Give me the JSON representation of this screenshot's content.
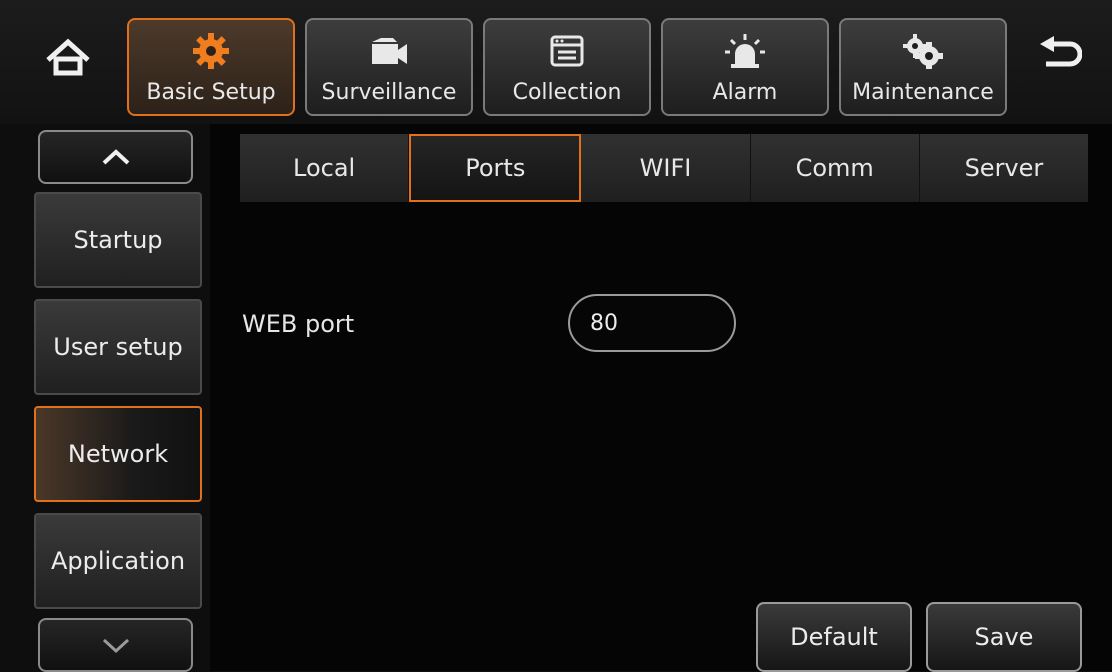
{
  "nav": {
    "tabs": [
      {
        "label": "Basic Setup",
        "icon": "gear-icon",
        "active": true
      },
      {
        "label": "Surveillance",
        "icon": "video-camera-icon",
        "active": false
      },
      {
        "label": "Collection",
        "icon": "window-icon",
        "active": false
      },
      {
        "label": "Alarm",
        "icon": "alarm-light-icon",
        "active": false
      },
      {
        "label": "Maintenance",
        "icon": "maintenance-gears-icon",
        "active": false
      }
    ],
    "home_icon": "home-icon",
    "back_icon": "back-arrow-icon"
  },
  "sidebar": {
    "up_icon": "chevron-up-icon",
    "down_icon": "chevron-down-icon",
    "items": [
      {
        "label": "Startup",
        "active": false
      },
      {
        "label": "User setup",
        "active": false
      },
      {
        "label": "Network",
        "active": true
      },
      {
        "label": "Application",
        "active": false
      }
    ]
  },
  "subtabs": [
    {
      "label": "Local",
      "active": false
    },
    {
      "label": "Ports",
      "active": true
    },
    {
      "label": "WIFI",
      "active": false
    },
    {
      "label": "Comm",
      "active": false
    },
    {
      "label": "Server",
      "active": false
    }
  ],
  "form": {
    "web_port_label": "WEB port",
    "web_port_value": "80"
  },
  "actions": {
    "default_label": "Default",
    "save_label": "Save"
  },
  "colors": {
    "accent": "#e0701a",
    "background": "#050505"
  }
}
